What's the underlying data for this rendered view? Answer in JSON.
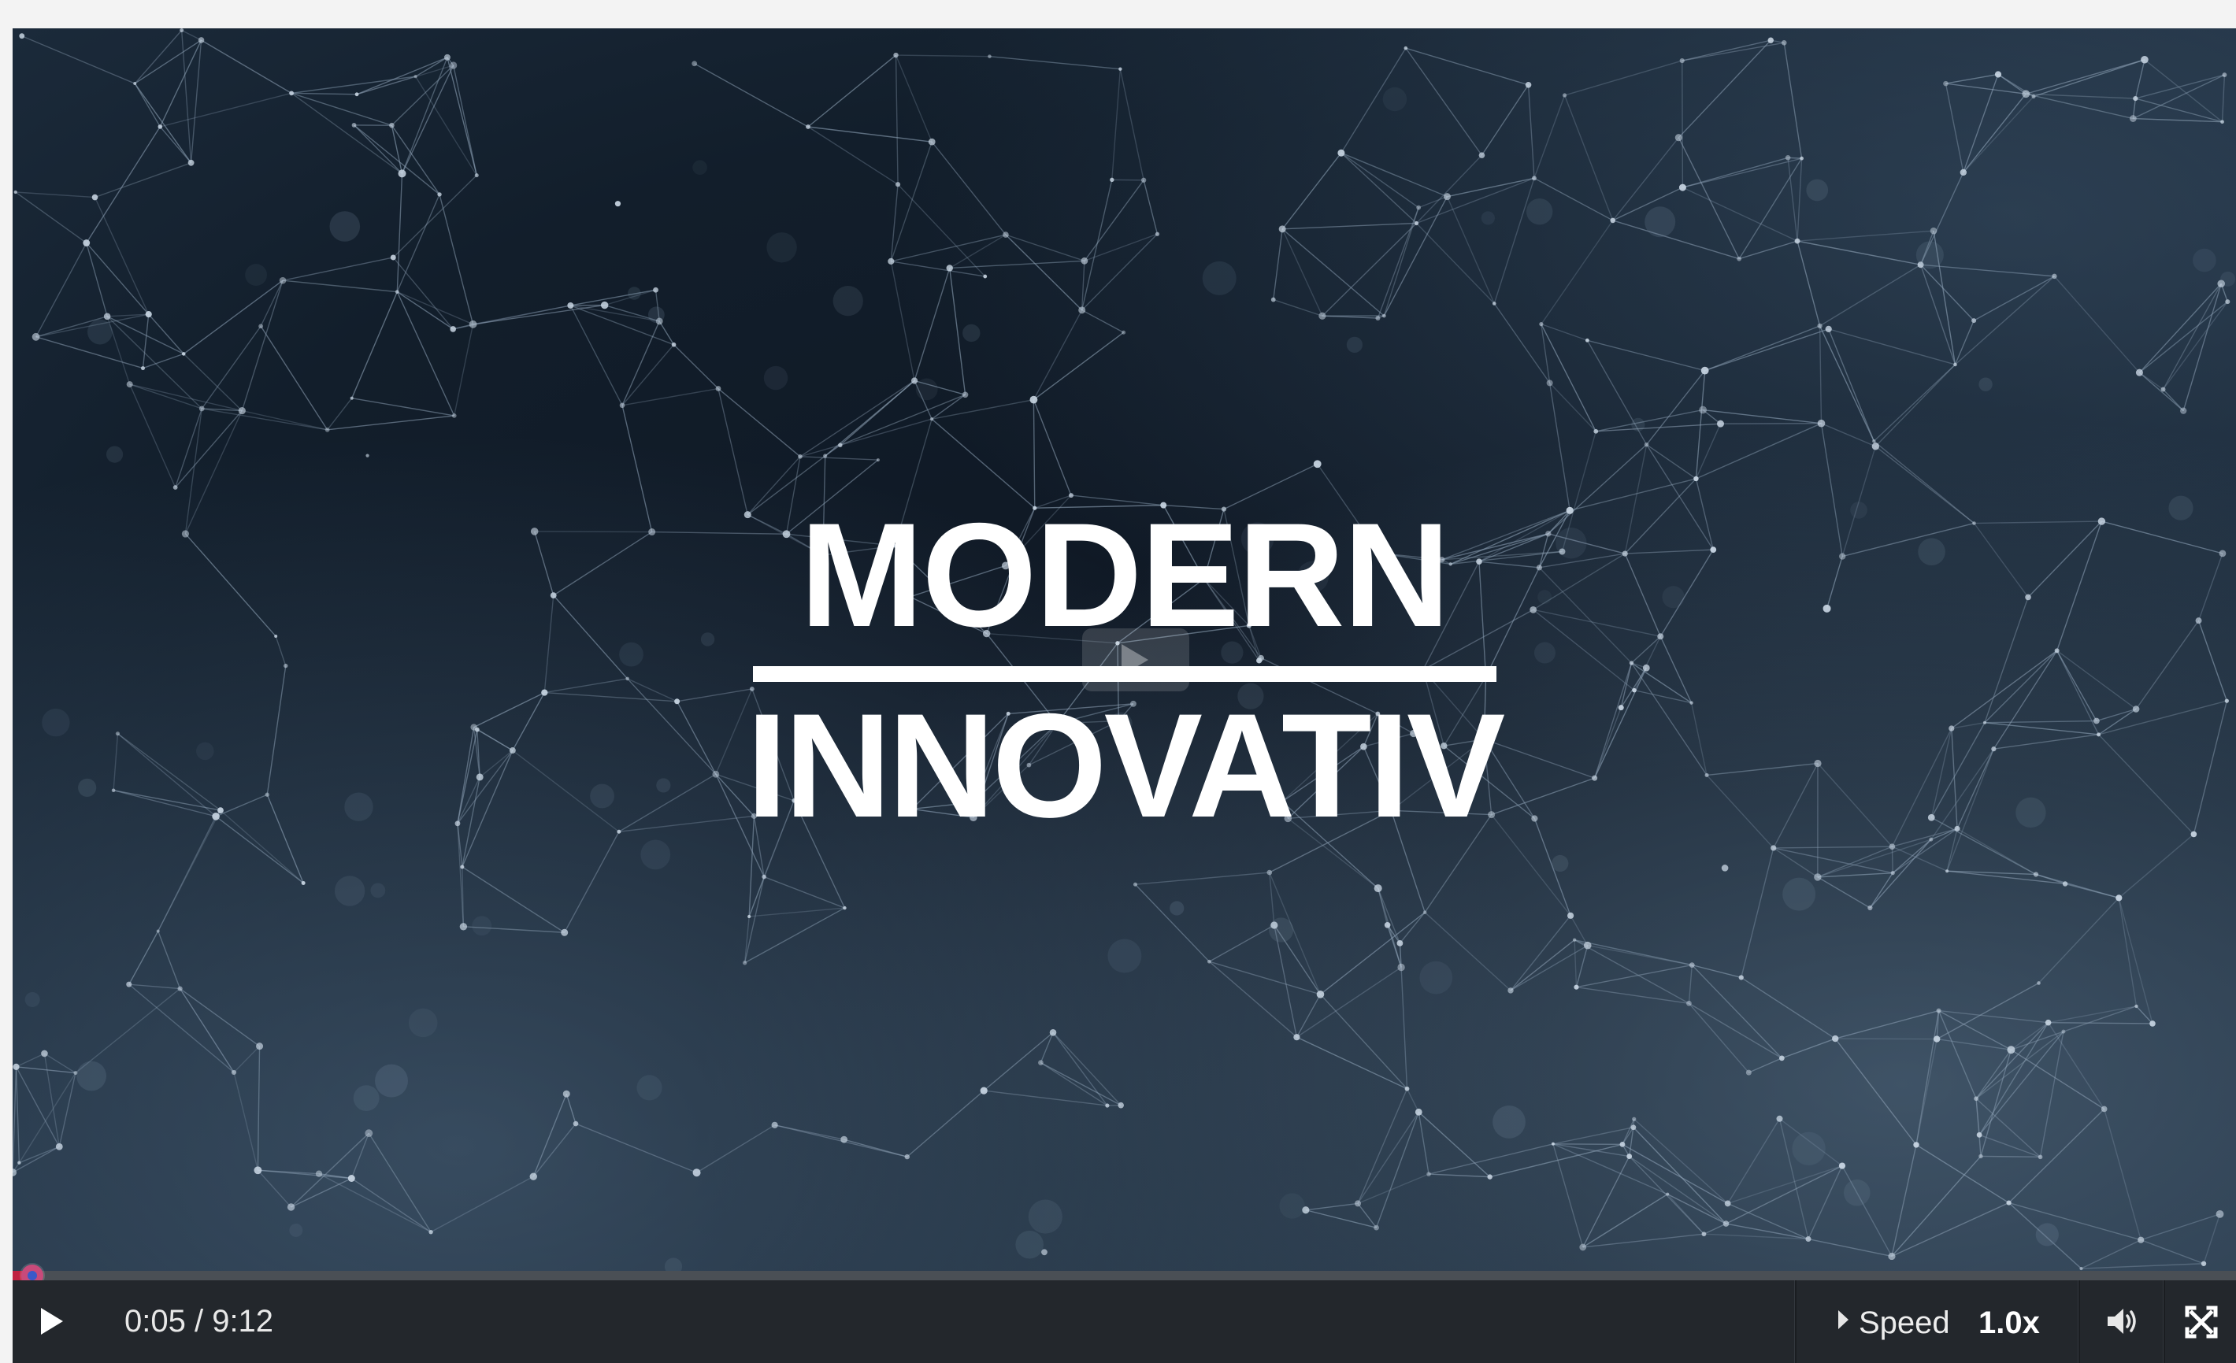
{
  "video": {
    "title_line1": "MODERN",
    "title_line2": "INNOVATIV"
  },
  "player": {
    "progress": 0.009,
    "time_display": "0:05 / 9:12",
    "speed_label": "Speed",
    "speed_value": "1.0x"
  },
  "icons": {
    "play": "play-icon",
    "center_play": "play-icon",
    "speed_caret": "caret-right-icon",
    "volume": "volume-icon",
    "fullscreen": "fullscreen-icon"
  },
  "colors": {
    "progress_fill": "#c02040",
    "handle": "#c94a7a",
    "controls_bg": "#23272c",
    "video_bg": "#101a26"
  }
}
